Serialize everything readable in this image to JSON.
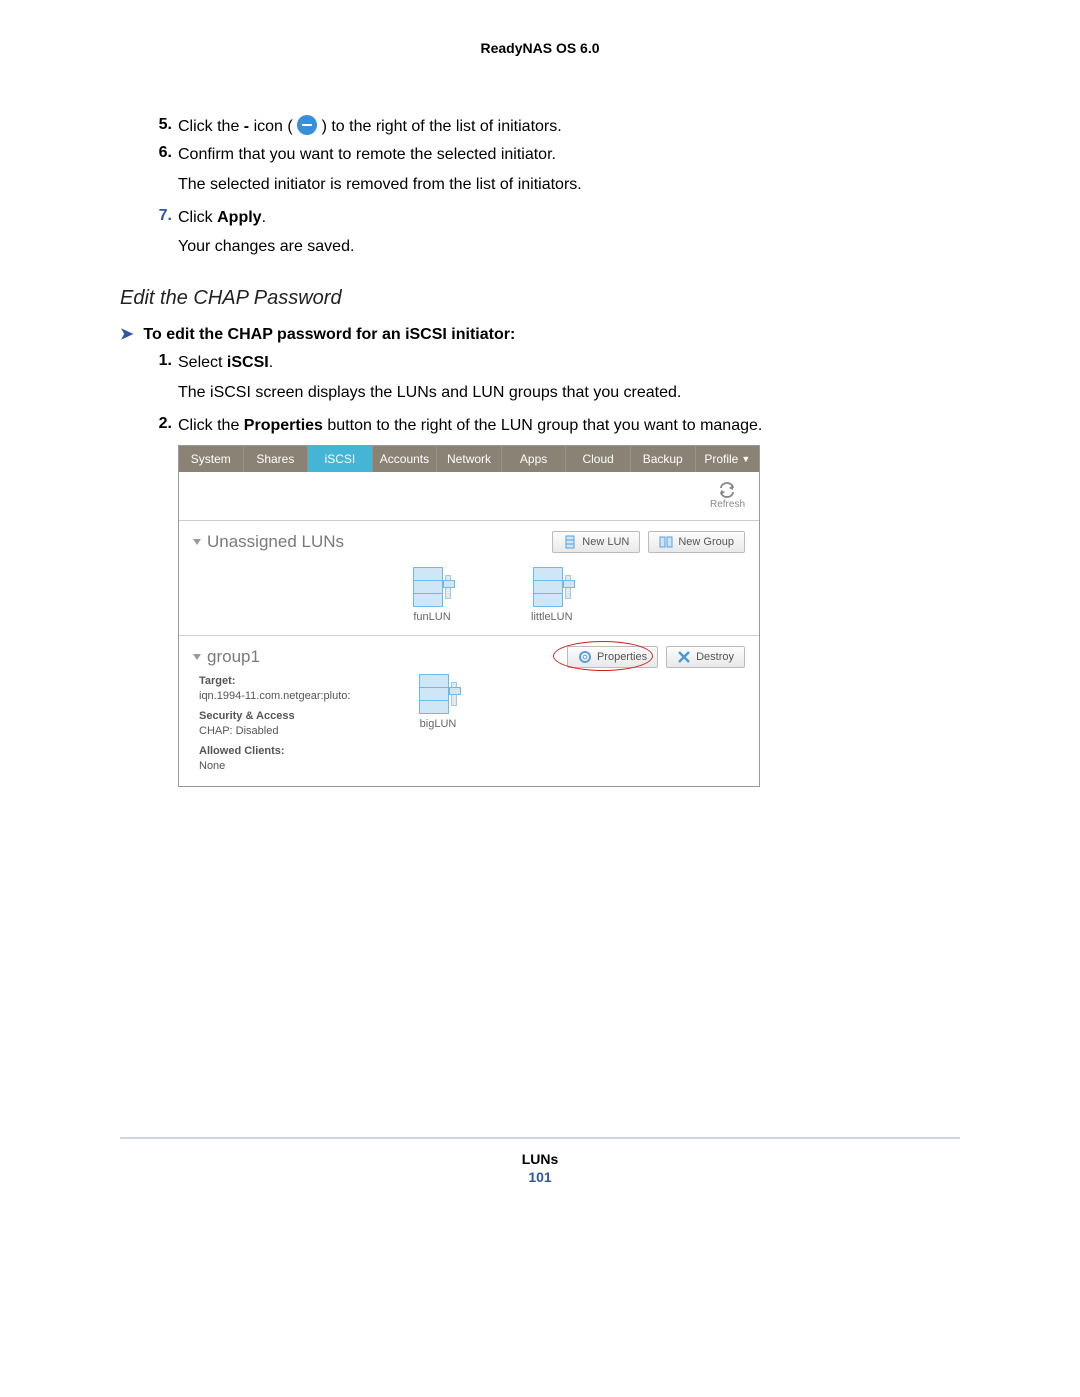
{
  "header": {
    "title": "ReadyNAS OS 6.0"
  },
  "steps_top": [
    {
      "num": "5.",
      "pre": "Click the ",
      "bold": "-",
      "mid": " icon ( ",
      "post": " ) to the right of the list of initiators."
    },
    {
      "num": "6.",
      "text": "Confirm that you want to remote the selected initiator."
    }
  ],
  "body_after_6": "The selected initiator is removed from the list of initiators.",
  "step7": {
    "num": "7.",
    "pre": "Click ",
    "bold": "Apply",
    "post": "."
  },
  "body_after_7": "Your changes are saved.",
  "subheading": "Edit the CHAP Password",
  "arrow_line": "To edit the CHAP password for an iSCSI initiator:",
  "steps_bottom": {
    "s1": {
      "num": "1.",
      "pre": "Select ",
      "bold": "iSCSI",
      "post": "."
    },
    "s1_body": "The iSCSI screen displays the LUNs and LUN groups that you created.",
    "s2": {
      "num": "2.",
      "pre": "Click the ",
      "bold": "Properties",
      "post": " button to the right of the LUN group that you want to manage."
    }
  },
  "screenshot": {
    "nav": [
      "System",
      "Shares",
      "iSCSI",
      "Accounts",
      "Network",
      "Apps",
      "Cloud",
      "Backup",
      "Profile"
    ],
    "active_index": 2,
    "refresh_label": "Refresh",
    "unassigned": {
      "title": "Unassigned LUNs",
      "buttons": {
        "new_lun": "New LUN",
        "new_group": "New Group"
      },
      "luns": [
        "funLUN",
        "littleLUN"
      ]
    },
    "group": {
      "title": "group1",
      "buttons": {
        "properties": "Properties",
        "destroy": "Destroy"
      },
      "target_label": "Target:",
      "target_value": "iqn.1994-11.com.netgear:pluto:",
      "sec_label": "Security & Access",
      "sec_value": "CHAP: Disabled",
      "allowed_label": "Allowed Clients:",
      "allowed_value": "None",
      "luns": [
        "bigLUN"
      ]
    }
  },
  "footer": {
    "label": "LUNs",
    "page": "101"
  }
}
